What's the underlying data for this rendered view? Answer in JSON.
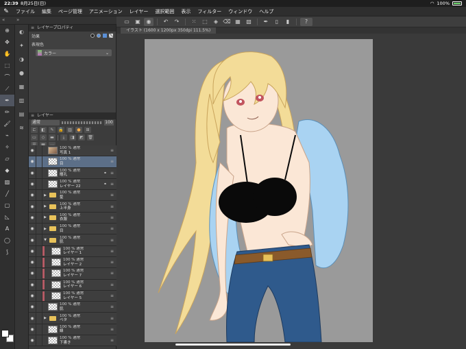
{
  "status": {
    "time": "22:39",
    "date": "8月25日(日)",
    "battery": "100%"
  },
  "menu": [
    "ファイル",
    "編集",
    "ページ管理",
    "アニメーション",
    "レイヤー",
    "選択範囲",
    "表示",
    "フィルター",
    "ウィンドウ",
    "ヘルプ"
  ],
  "property_panel": {
    "title": "レイヤープロパティ",
    "effect_label": "効果",
    "expression_color_label": "表現色",
    "expression_color_value": "カラー"
  },
  "layer_panel": {
    "title": "レイヤー",
    "blend_mode": "通常",
    "opacity": "100"
  },
  "layers": [
    {
      "mode": "100 % 通常",
      "name": "写真 1",
      "kind": "photo",
      "selected": false
    },
    {
      "mode": "100 % 通常",
      "name": "目",
      "kind": "layer",
      "selected": true
    },
    {
      "mode": "100 % 通常",
      "name": "瞳孔",
      "kind": "layer",
      "selected": false
    },
    {
      "mode": "100 % 通常",
      "name": "レイヤー 22",
      "kind": "layer",
      "selected": false
    },
    {
      "mode": "100 % 通常",
      "name": "髪",
      "kind": "folder",
      "selected": false
    },
    {
      "mode": "100 % 通常",
      "name": "上半身",
      "kind": "folder",
      "selected": false
    },
    {
      "mode": "100 % 通常",
      "name": "衣服",
      "kind": "folder",
      "selected": false
    },
    {
      "mode": "100 % 通常",
      "name": "目",
      "kind": "folder",
      "selected": false
    },
    {
      "mode": "100 % 通常",
      "name": "肌",
      "kind": "folder-open",
      "selected": false
    },
    {
      "mode": "100 % 通常",
      "name": "レイヤー 1",
      "kind": "clip",
      "selected": false
    },
    {
      "mode": "100 % 通常",
      "name": "レイヤー 2",
      "kind": "clip",
      "selected": false
    },
    {
      "mode": "100 % 通常",
      "name": "レイヤー 7",
      "kind": "clip",
      "selected": false
    },
    {
      "mode": "100 % 通常",
      "name": "レイヤー 6",
      "kind": "clip",
      "selected": false
    },
    {
      "mode": "100 % 通常",
      "name": "レイヤー 5",
      "kind": "clip",
      "selected": false
    },
    {
      "mode": "100 % 通常",
      "name": "肌",
      "kind": "layer",
      "selected": false
    },
    {
      "mode": "100 % 通常",
      "name": "ベタ",
      "kind": "folder",
      "selected": false
    },
    {
      "mode": "100 % 通常",
      "name": "線",
      "kind": "layer",
      "selected": false
    },
    {
      "mode": "100 % 通常",
      "name": "下書き",
      "kind": "layer",
      "selected": false
    }
  ],
  "document": {
    "tab_title": "イラスト (1600 x 1200px 350dpi 111.5%)"
  },
  "colors": {
    "accent": "#5c6f88",
    "canvas_bg": "#9a9a9a",
    "hair": "#f3dc98",
    "jacket": "#a9d3f2",
    "jeans": "#2f5a8c",
    "bra": "#0a0a0a",
    "skin": "#fbe7d6"
  },
  "icons": {
    "toolbar": [
      "magnify-icon",
      "move-icon",
      "hand-icon",
      "selection-icon",
      "lasso-icon",
      "eyedropper-icon",
      "pen-icon",
      "pencil-icon",
      "brush-icon",
      "airbrush-icon",
      "decoration-icon",
      "eraser-icon",
      "fill-icon",
      "gradient-icon",
      "figure-icon",
      "frame-icon",
      "ruler-icon",
      "text-icon",
      "balloon-icon",
      "line-correction-icon"
    ],
    "command": [
      "new-icon",
      "save-icon",
      "settings-icon",
      "undo-icon",
      "redo-icon",
      "select-all-icon",
      "transform-icon",
      "fill-icon",
      "clear-icon",
      "pen-settings-icon",
      "help-icon"
    ]
  }
}
